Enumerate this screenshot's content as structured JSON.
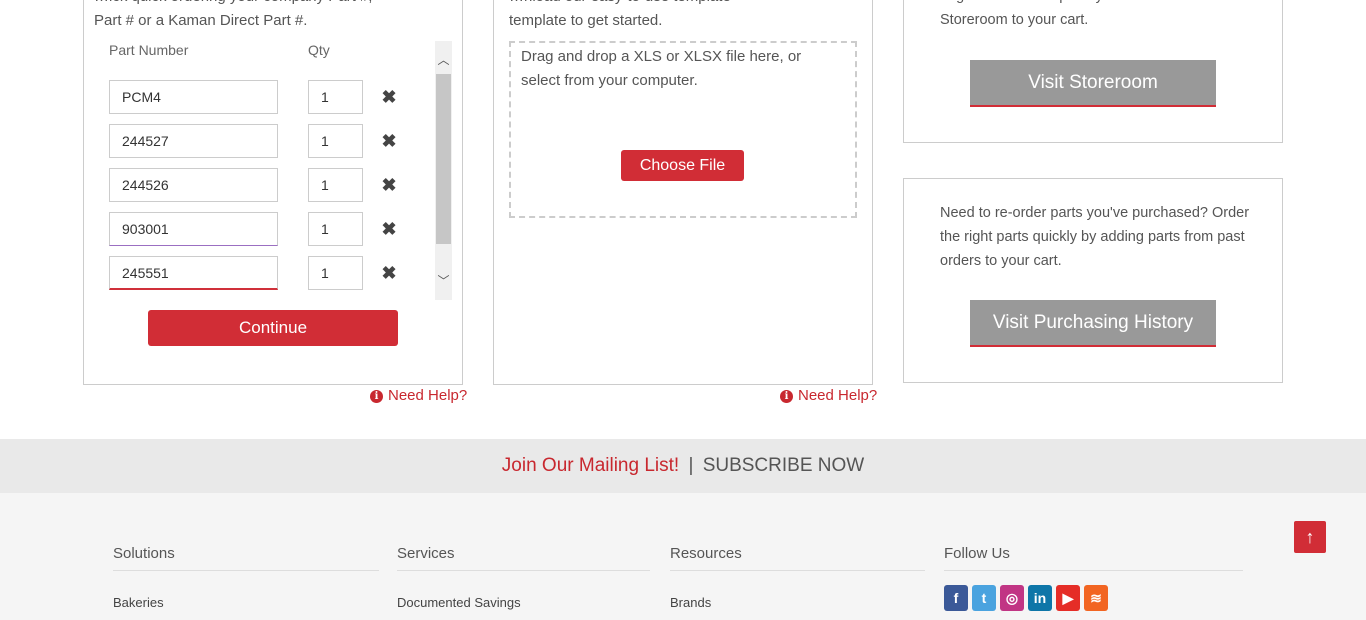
{
  "quick_order": {
    "intro_line1": "…ick quick ordering your company Part #,",
    "intro_line2": "Part # or a Kaman Direct Part #.",
    "col_part": "Part Number",
    "col_qty": "Qty",
    "rows": [
      {
        "part": "PCM4",
        "qty": "1"
      },
      {
        "part": "244527",
        "qty": "1"
      },
      {
        "part": "244526",
        "qty": "1"
      },
      {
        "part": "903001",
        "qty": "1"
      },
      {
        "part": "245551",
        "qty": "1"
      }
    ],
    "continue_label": "Continue",
    "help_label": "Need Help?"
  },
  "upload": {
    "intro_line1": "…nload our easy-to-use template",
    "intro_line2": "template to get started.",
    "drop_text": "Drag and drop a XLS or XLSX file here, or select from your computer.",
    "choose_label": "Choose File",
    "help_label": "Need Help?"
  },
  "storeroom": {
    "intro_line1": "Organize and add parts you need or an entire",
    "intro_line2": "Storeroom to your cart.",
    "button_label": "Visit Storeroom"
  },
  "history": {
    "text": "Need to re-order parts you've purchased? Order the right parts quickly by adding parts from past orders to your cart.",
    "button_label": "Visit Purchasing History"
  },
  "mailing": {
    "join": "Join Our Mailing List!",
    "separator": "|",
    "subscribe": "SUBSCRIBE NOW"
  },
  "footer": {
    "solutions": {
      "heading": "Solutions",
      "first": "Bakeries"
    },
    "services": {
      "heading": "Services",
      "first": "Documented Savings"
    },
    "resources": {
      "heading": "Resources",
      "first": "Brands"
    },
    "follow": {
      "heading": "Follow Us"
    }
  },
  "social": [
    {
      "name": "facebook-icon",
      "glyph": "f",
      "color": "#3b5998"
    },
    {
      "name": "twitter-icon",
      "glyph": "t",
      "color": "#4aa3df"
    },
    {
      "name": "instagram-icon",
      "glyph": "◎",
      "color": "#c13584"
    },
    {
      "name": "linkedin-icon",
      "glyph": "in",
      "color": "#0e76a8"
    },
    {
      "name": "youtube-icon",
      "glyph": "▶",
      "color": "#e52d27"
    },
    {
      "name": "rss-icon",
      "glyph": "≋",
      "color": "#f26522"
    }
  ],
  "colors": {
    "accent": "#d12d36",
    "grey_button": "#999999"
  }
}
